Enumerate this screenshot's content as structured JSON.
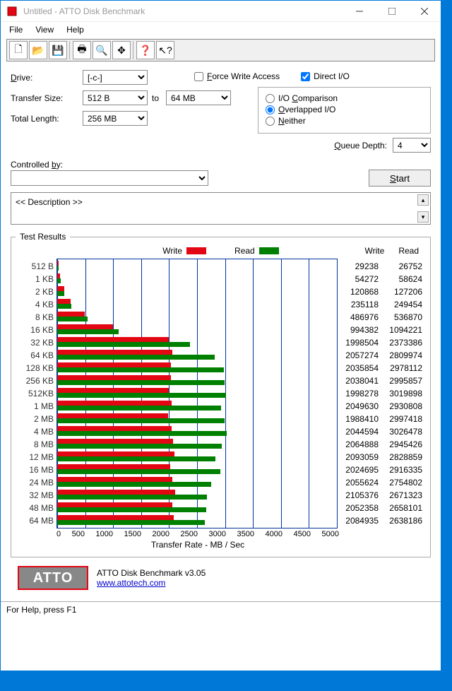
{
  "title": "Untitled - ATTO Disk Benchmark",
  "menu": {
    "file": "File",
    "view": "View",
    "help": "Help"
  },
  "toolbar": {
    "new": "new",
    "open": "open",
    "save": "save",
    "print": "print",
    "preview": "preview",
    "move": "move",
    "help": "help",
    "whatsthis": "whatsthis"
  },
  "labels": {
    "drive": "Drive:",
    "transfer_size": "Transfer Size:",
    "to": "to",
    "total_length": "Total Length:",
    "force_write": "Force Write Access",
    "direct_io": "Direct I/O",
    "io_comp": "I/O Comparison",
    "overlapped": "Overlapped I/O",
    "neither": "Neither",
    "queue_depth": "Queue Depth:",
    "controlled_by": "Controlled by:",
    "start": "Start",
    "description": "<< Description >>",
    "results": "Test Results",
    "write": "Write",
    "read": "Read",
    "xaxis": "Transfer Rate - MB / Sec"
  },
  "values": {
    "drive": "[-c-]",
    "size_from": "512 B",
    "size_to": "64 MB",
    "total_length": "256 MB",
    "queue_depth": "4",
    "force_write_checked": false,
    "direct_io_checked": true,
    "radio_selected": "overlapped"
  },
  "footer": {
    "logo": "ATTO",
    "product": "ATTO Disk Benchmark v3.05",
    "url": "www.attotech.com",
    "status": "For Help, press F1"
  },
  "chart_data": {
    "type": "bar",
    "title": "Test Results",
    "xlabel": "Transfer Rate - MB / Sec",
    "ylabel": "Transfer Size",
    "xlim": [
      0,
      5000
    ],
    "xticks": [
      0,
      500,
      1000,
      1500,
      2000,
      2500,
      3000,
      3500,
      4000,
      4500,
      5000
    ],
    "categories": [
      "512 B",
      "1 KB",
      "2 KB",
      "4 KB",
      "8 KB",
      "16 KB",
      "32 KB",
      "64 KB",
      "128 KB",
      "256 KB",
      "512KB",
      "1 MB",
      "2 MB",
      "4 MB",
      "8 MB",
      "12 MB",
      "16 MB",
      "24 MB",
      "32 MB",
      "48 MB",
      "64 MB"
    ],
    "series": [
      {
        "name": "Write",
        "color": "#e30613",
        "values": [
          29238,
          54272,
          120868,
          235118,
          486976,
          994382,
          1998504,
          2057274,
          2035854,
          2038041,
          1998278,
          2049630,
          1988410,
          2044594,
          2064888,
          2093059,
          2024695,
          2055624,
          2105376,
          2052358,
          2084935
        ],
        "display_values": [
          "29238",
          "54272",
          "120868",
          "235118",
          "486976",
          "994382",
          "1998504",
          "2057274",
          "2035854",
          "2038041",
          "1998278",
          "2049630",
          "1988410",
          "2044594",
          "2064888",
          "2093059",
          "2024695",
          "2055624",
          "2105376",
          "2052358",
          "2084935"
        ]
      },
      {
        "name": "Read",
        "color": "#008000",
        "values": [
          26752,
          58624,
          127206,
          249454,
          536870,
          1094221,
          2373386,
          2809974,
          2978112,
          2995857,
          3019898,
          2930808,
          2997418,
          3026478,
          2945426,
          2828859,
          2916335,
          2754802,
          2671323,
          2658101,
          2638186
        ],
        "display_values": [
          "26752",
          "58624",
          "127206",
          "249454",
          "536870",
          "1094221",
          "2373386",
          "2809974",
          "2978112",
          "2995857",
          "3019898",
          "2930808",
          "2997418",
          "3026478",
          "2945426",
          "2828859",
          "2916335",
          "2754802",
          "2671323",
          "2658101",
          "2638186"
        ]
      }
    ]
  }
}
